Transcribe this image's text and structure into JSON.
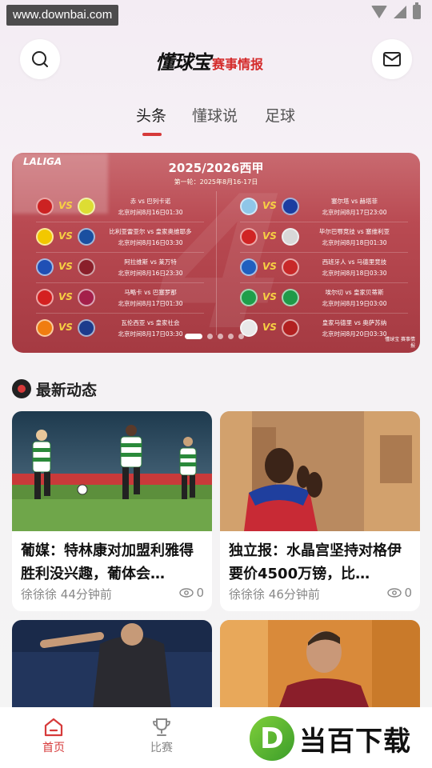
{
  "status_bar": {
    "watermark": "www.downbai.com"
  },
  "header": {
    "logo_main": "懂球宝",
    "logo_sub": "赛事情报"
  },
  "tabs": [
    {
      "label": "头条",
      "active": true
    },
    {
      "label": "懂球说",
      "active": false
    },
    {
      "label": "足球",
      "active": false
    }
  ],
  "banner": {
    "league": "LALIGA",
    "title": "2025/2026西甲",
    "subtitle": "第一轮：2025年8月16-17日",
    "left_matches": [
      {
        "teams": "赤 vs 巴列卡诺",
        "time": "北京时间8月16日01:30",
        "home_color": "#c22",
        "away_color": "#dd3"
      },
      {
        "teams": "比利亚雷亚尔 vs 皇家奥维耶多",
        "time": "北京时间8月16日03:30",
        "home_color": "#f2c800",
        "away_color": "#1a4fa0"
      },
      {
        "teams": "阿拉维斯 vs 莱万特",
        "time": "北京时间8月16日23:30",
        "home_color": "#1f4fb5",
        "away_color": "#8a1f2a"
      },
      {
        "teams": "马略卡 vs 巴塞罗那",
        "time": "北京时间8月17日01:30",
        "home_color": "#d42020",
        "away_color": "#a41f4a"
      },
      {
        "teams": "瓦伦西亚 vs 皇家社会",
        "time": "北京时间8月17日03:30",
        "home_color": "#f07d10",
        "away_color": "#1d3b8c"
      }
    ],
    "right_matches": [
      {
        "teams": "塞尔塔 vs 赫塔菲",
        "time": "北京时间8月17日23:00",
        "home_color": "#8fc6e8",
        "away_color": "#1a3da0"
      },
      {
        "teams": "毕尔巴鄂竞技 vs 塞维利亚",
        "time": "北京时间8月18日01:30",
        "home_color": "#d02424",
        "away_color": "#d8d8d8"
      },
      {
        "teams": "西班牙人 vs 马德里竞技",
        "time": "北京时间8月18日03:30",
        "home_color": "#1f5fbf",
        "away_color": "#c82828"
      },
      {
        "teams": "埃尔切 vs 皇家贝蒂斯",
        "time": "北京时间8月19日03:00",
        "home_color": "#1e9e4a",
        "away_color": "#1f9a48"
      },
      {
        "teams": "皇家马德里 vs 奥萨苏纳",
        "time": "北京时间8月20日03:30",
        "home_color": "#e8e8e8",
        "away_color": "#b22020"
      }
    ],
    "brand": "懂球宝 赛事情报",
    "pages": 5,
    "active_page": 0
  },
  "section": {
    "title": "最新动态"
  },
  "articles": [
    {
      "title": "葡媒：特林康对加盟利雅得胜利没兴趣，葡体会…",
      "author": "徐徐徐",
      "time": "44分钟前",
      "views": "0"
    },
    {
      "title": "独立报：水晶宫坚持对格伊要价4500万镑，比…",
      "author": "徐徐徐",
      "time": "46分钟前",
      "views": "0"
    }
  ],
  "bottom_nav": [
    {
      "label": "首页",
      "active": true
    },
    {
      "label": "比赛",
      "active": false
    }
  ],
  "brand_watermark": {
    "letter": "D",
    "text": "当百下载"
  },
  "colors": {
    "accent": "#d63a3a",
    "banner": "#b94a52"
  }
}
